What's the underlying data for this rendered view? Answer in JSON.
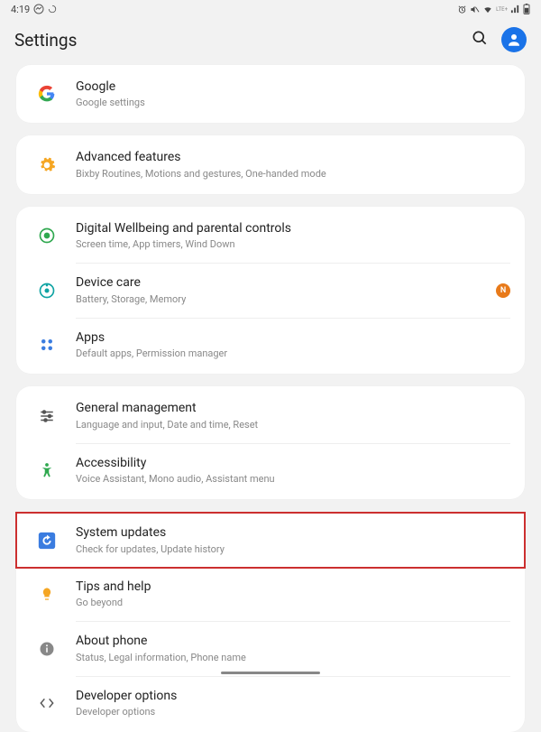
{
  "status": {
    "time": "4:19",
    "badge_n": "N"
  },
  "header": {
    "title": "Settings"
  },
  "groups": [
    {
      "items": [
        {
          "id": "google",
          "title": "Google",
          "sub": "Google settings"
        }
      ]
    },
    {
      "items": [
        {
          "id": "advanced",
          "title": "Advanced features",
          "sub": "Bixby Routines, Motions and gestures, One-handed mode"
        }
      ]
    },
    {
      "items": [
        {
          "id": "wellbeing",
          "title": "Digital Wellbeing and parental controls",
          "sub": "Screen time, App timers, Wind Down"
        },
        {
          "id": "devicecare",
          "title": "Device care",
          "sub": "Battery, Storage, Memory",
          "badge": true
        },
        {
          "id": "apps",
          "title": "Apps",
          "sub": "Default apps, Permission manager"
        }
      ]
    },
    {
      "items": [
        {
          "id": "general",
          "title": "General management",
          "sub": "Language and input, Date and time, Reset"
        },
        {
          "id": "accessibility",
          "title": "Accessibility",
          "sub": "Voice Assistant, Mono audio, Assistant menu"
        }
      ]
    },
    {
      "items": [
        {
          "id": "system",
          "title": "System updates",
          "sub": "Check for updates, Update history",
          "highlight": true
        },
        {
          "id": "tips",
          "title": "Tips and help",
          "sub": "Go beyond"
        },
        {
          "id": "about",
          "title": "About phone",
          "sub": "Status, Legal information, Phone name"
        },
        {
          "id": "developer",
          "title": "Developer options",
          "sub": "Developer options"
        }
      ]
    }
  ]
}
